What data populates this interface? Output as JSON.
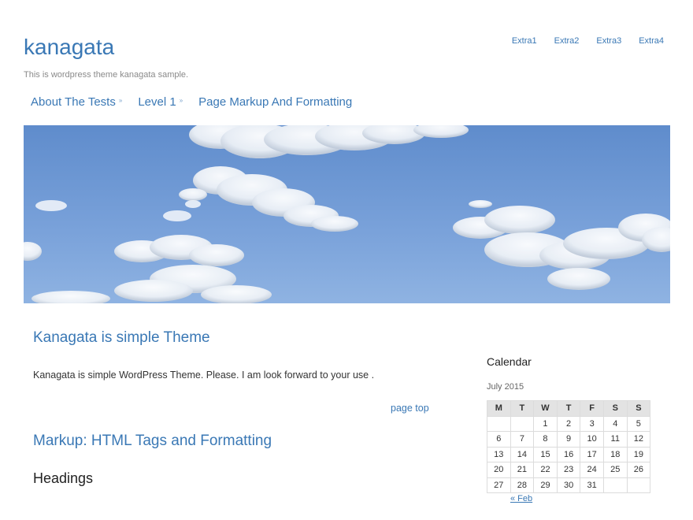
{
  "site": {
    "title": "kanagata",
    "tagline": "This is wordpress theme kanagata sample."
  },
  "extra_nav": [
    "Extra1",
    "Extra2",
    "Extra3",
    "Extra4"
  ],
  "main_nav": [
    {
      "label": "About The Tests",
      "has_children": true
    },
    {
      "label": "Level 1",
      "has_children": true
    },
    {
      "label": "Page Markup And Formatting",
      "has_children": false
    }
  ],
  "hero": {
    "icon": "sky-clouds-image",
    "sky_color": "#6a93cf"
  },
  "posts": [
    {
      "title": "Kanagata is simple Theme",
      "body": "Kanagata is simple WordPress Theme. Please. I am look forward to your use .",
      "page_top": "page top"
    },
    {
      "title": "Markup: HTML Tags and Formatting",
      "subheading": "Headings"
    }
  ],
  "sidebar": {
    "widget_title": "Calendar",
    "calendar": {
      "caption": "July 2015",
      "headers": [
        "M",
        "T",
        "W",
        "T",
        "F",
        "S",
        "S"
      ],
      "rows": [
        [
          "",
          "",
          "1",
          "2",
          "3",
          "4",
          "5"
        ],
        [
          "6",
          "7",
          "8",
          "9",
          "10",
          "11",
          "12"
        ],
        [
          "13",
          "14",
          "15",
          "16",
          "17",
          "18",
          "19"
        ],
        [
          "20",
          "21",
          "22",
          "23",
          "24",
          "25",
          "26"
        ],
        [
          "27",
          "28",
          "29",
          "30",
          "31",
          "",
          ""
        ]
      ],
      "prev_label": "« Feb"
    }
  },
  "colors": {
    "link": "#3a78b5",
    "text": "#333333"
  }
}
